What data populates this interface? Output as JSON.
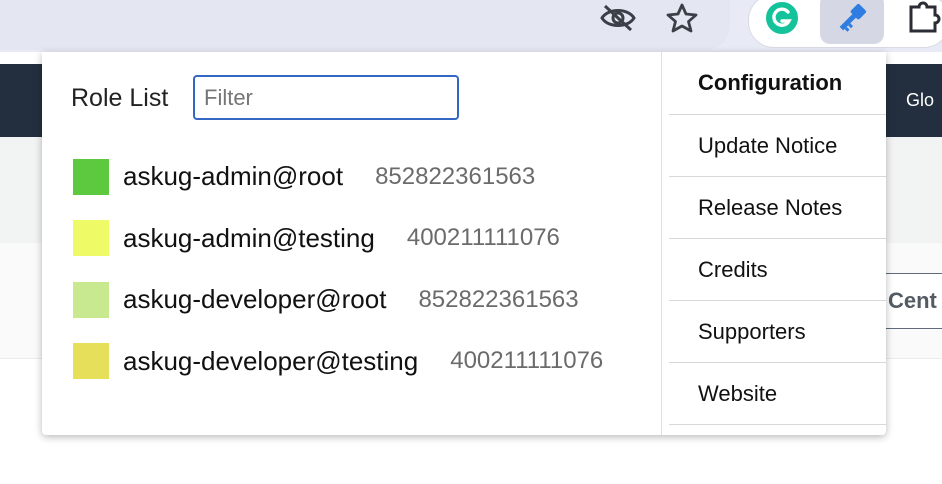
{
  "popup": {
    "title": "Role List",
    "filter": {
      "placeholder": "Filter",
      "value": ""
    },
    "roles": [
      {
        "name": "askug-admin@root",
        "account": "852822361563",
        "color": "#5cc93f"
      },
      {
        "name": "askug-admin@testing",
        "account": "400211111076",
        "color": "#eefa66"
      },
      {
        "name": "askug-developer@root",
        "account": "852822361563",
        "color": "#c8e990"
      },
      {
        "name": "askug-developer@testing",
        "account": "400211111076",
        "color": "#e5df5a"
      }
    ],
    "menu": {
      "header": "Configuration",
      "items": [
        "Update Notice",
        "Release Notes",
        "Credits",
        "Supporters",
        "Website"
      ]
    }
  },
  "background": {
    "nav_text": "Glo",
    "tab_text": "Cent"
  },
  "toolbar": {
    "icons": [
      "eye-off-icon",
      "star-icon",
      "grammarly-icon",
      "key-extension-icon",
      "puzzle-icon"
    ]
  }
}
